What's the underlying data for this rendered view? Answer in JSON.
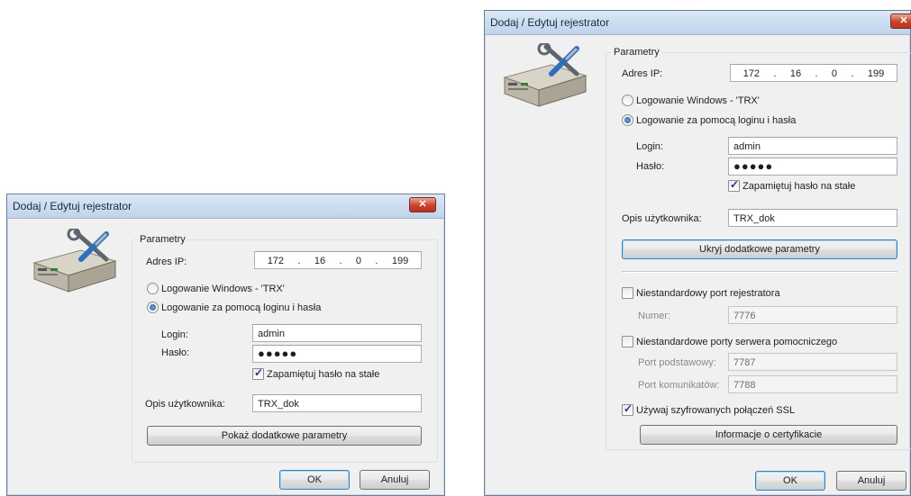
{
  "small_dialog": {
    "title": "Dodaj / Edytuj rejestrator",
    "close_label": "x",
    "group_title": "Parametry",
    "ip_label": "Adres IP:",
    "ip": [
      "172",
      ".",
      "16",
      ".",
      "0",
      ".",
      "199"
    ],
    "radio_windows_label": "Logowanie Windows - 'TRX'",
    "radio_login_label": "Logowanie za pomocą loginu i hasła",
    "login_label": "Login:",
    "login_value": "admin",
    "password_label": "Hasło:",
    "password_value": "●●●●●",
    "remember_label": "Zapamiętuj hasło na stałe",
    "user_desc_label": "Opis użytkownika:",
    "user_desc_value": "TRX_dok",
    "toggle_button": "Pokaż dodatkowe parametry",
    "ok": "OK",
    "cancel": "Anuluj"
  },
  "large_dialog": {
    "title": "Dodaj / Edytuj rejestrator",
    "close_label": "x",
    "group_title": "Parametry",
    "ip_label": "Adres IP:",
    "ip": [
      "172",
      ".",
      "16",
      ".",
      "0",
      ".",
      "199"
    ],
    "radio_windows_label": "Logowanie Windows - 'TRX'",
    "radio_login_label": "Logowanie za pomocą loginu i hasła",
    "login_label": "Login:",
    "login_value": "admin",
    "password_label": "Hasło:",
    "password_value": "●●●●●",
    "remember_label": "Zapamiętuj hasło na stałe",
    "user_desc_label": "Opis użytkownika:",
    "user_desc_value": "TRX_dok",
    "toggle_button": "Ukryj dodatkowe parametry",
    "custom_port_label": "Niestandardowy port rejestratora",
    "number_label": "Numer:",
    "number_value": "7776",
    "custom_server_ports_label": "Niestandardowe porty serwera pomocniczego",
    "base_port_label": "Port podstawowy:",
    "base_port_value": "7787",
    "comm_port_label": "Port komunikatów:",
    "comm_port_value": "7788",
    "ssl_label": "Używaj szyfrowanych połączeń SSL",
    "cert_button": "Informacje o certyfikacie",
    "ok": "OK",
    "cancel": "Anuluj"
  },
  "state": {
    "radio_windows": false,
    "radio_login": true,
    "remember_checked": true,
    "custom_port_checked": false,
    "custom_server_ports_checked": false,
    "ssl_checked": true
  },
  "icons": [
    "device-tools-icon",
    "close-icon"
  ]
}
